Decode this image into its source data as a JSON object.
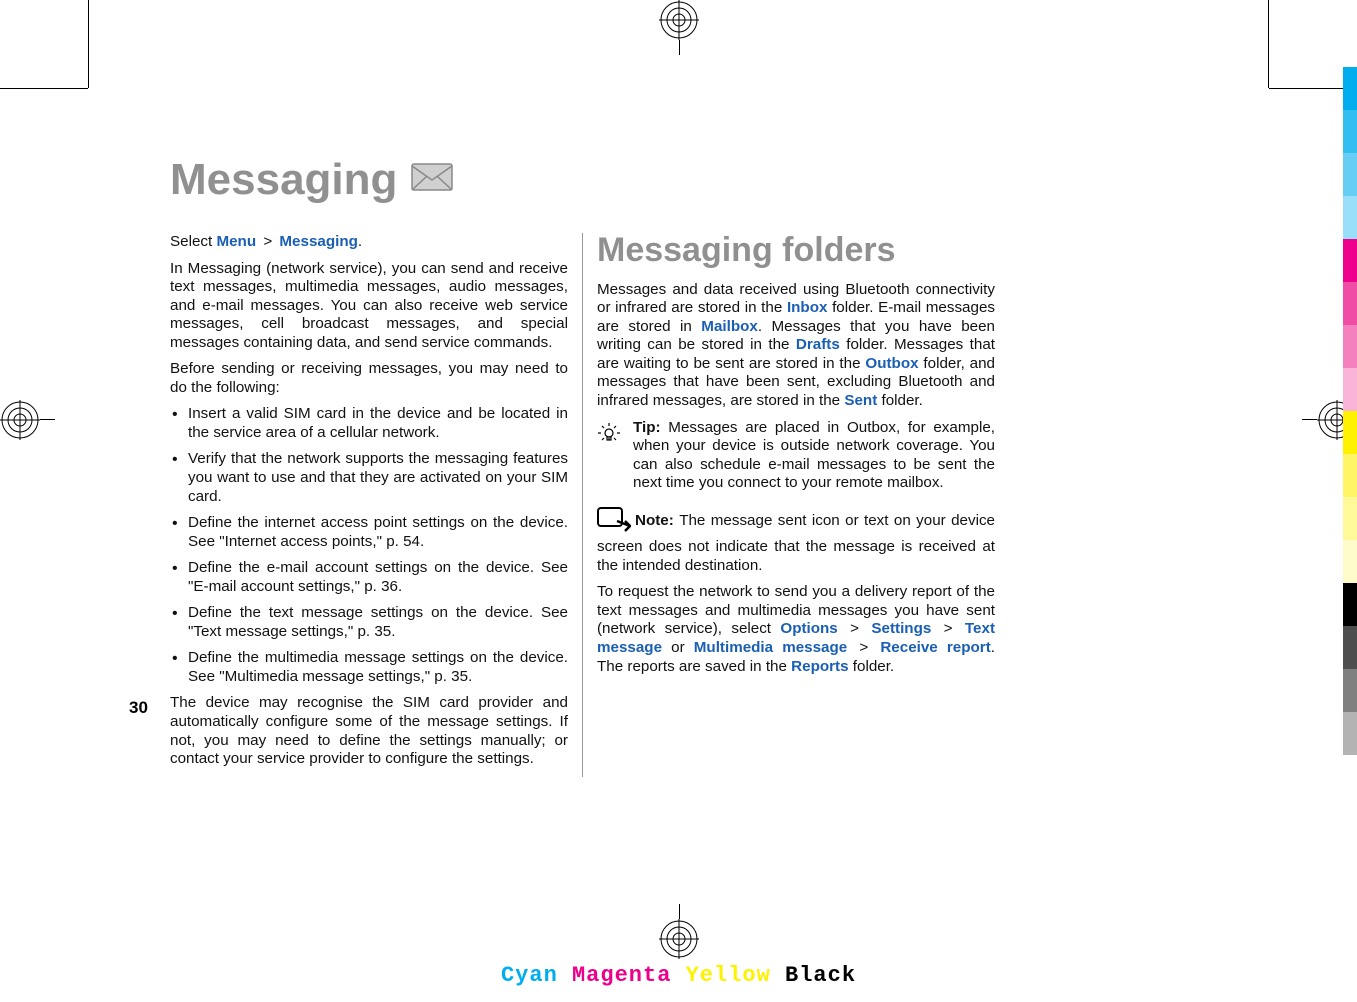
{
  "page_number": "30",
  "chapter_title": "Messaging",
  "left_col": {
    "intro_select": "Select ",
    "menu": "Menu",
    "messaging": "Messaging",
    "period": ".",
    "intro_para": "In Messaging (network service), you can send and receive text messages, multimedia messages, audio messages, and e-mail messages. You can also receive web service messages, cell broadcast messages, and special messages containing data, and send service commands.",
    "before_para": "Before sending or receiving messages, you may need to do the following:",
    "bullets": [
      "Insert a valid SIM card in the device and be located in the service area of a cellular network.",
      "Verify that the network supports the messaging features you want to use and that they are activated on your SIM card.",
      "Define the internet access point settings on the device. See \"Internet access points,\" p. 54.",
      "Define the e-mail account settings on the device. See \"E-mail account settings,\" p. 36.",
      "Define the text message settings on the device. See \"Text message settings,\" p. 35.",
      "Define the multimedia message settings on the device. See \"Multimedia message settings,\" p. 35."
    ],
    "closing": "The device may recognise the SIM card provider and automatically configure some of the message settings. If not, you may need to define the settings manually; or contact your service provider to configure the settings."
  },
  "right_col": {
    "section_title": "Messaging folders",
    "p1_a": "Messages and data received using Bluetooth connectivity or infrared are stored in the ",
    "inbox": "Inbox",
    "p1_b": " folder. E-mail messages are stored in ",
    "mailbox": "Mailbox",
    "p1_c": ". Messages that you have been writing can be stored in the ",
    "drafts": "Drafts",
    "p1_d": " folder. Messages that are waiting to be sent are stored in the ",
    "outbox": "Outbox",
    "p1_e": " folder, and messages that have been sent, excluding Bluetooth and infrared messages, are stored in the ",
    "sent": "Sent",
    "p1_f": " folder.",
    "tip_label": "Tip: ",
    "tip_text": "Messages are placed in Outbox, for example, when your device is outside network coverage. You can also schedule e-mail messages to be sent the next time you connect to your remote mailbox.",
    "note_label": "Note: ",
    "note_text": "The message sent icon or text on your device screen does not indicate that the message is received at the intended destination.",
    "p2_a": "To request the network to send you a delivery report of the text messages and multimedia messages you have sent (network service), select ",
    "options": "Options",
    "settings": "Settings",
    "text_message": "Text message",
    "or": " or ",
    "mms": "Multimedia message",
    "receive_report": "Receive report",
    "p2_b": ". The reports are saved in the ",
    "reports": "Reports",
    "p2_c": " folder."
  },
  "cmyk": {
    "c": "Cyan",
    "m": "Magenta",
    "y": "Yellow",
    "k": "Black"
  },
  "swatches": [
    "#00AEEF",
    "#33BEF2",
    "#66CEF5",
    "#99DFF9",
    "#EC008C",
    "#F04DA6",
    "#F580BF",
    "#F9B3D9",
    "#FFF200",
    "#FFF566",
    "#FFF999",
    "#FFFCCC",
    "#000000",
    "#4D4D4D",
    "#808080",
    "#B3B3B3"
  ]
}
